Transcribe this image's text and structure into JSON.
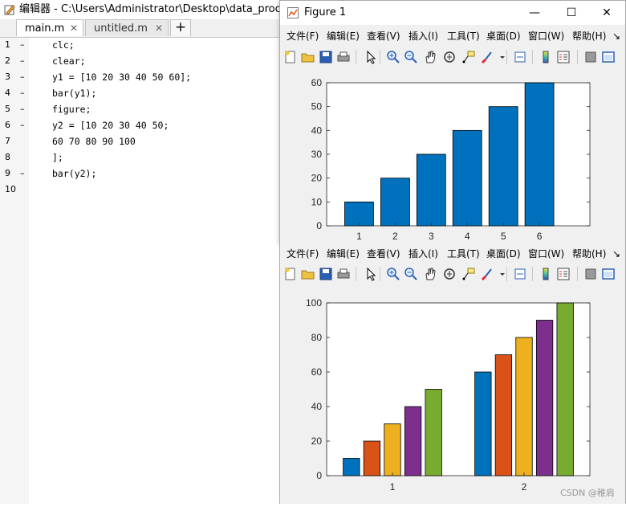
{
  "editor": {
    "title": "编辑器 - C:\\Users\\Administrator\\Desktop\\data_process\\",
    "tabs": [
      {
        "label": "main.m",
        "close": "✕"
      },
      {
        "label": "untitled.m",
        "close": "✕"
      }
    ],
    "add_tab": "+",
    "lines": [
      {
        "num": "1",
        "dash": "–",
        "code": "clc;"
      },
      {
        "num": "2",
        "dash": "–",
        "code": "clear;"
      },
      {
        "num": "3",
        "dash": "–",
        "code": "y1 = [10 20 30 40 50 60];"
      },
      {
        "num": "4",
        "dash": "–",
        "code": "bar(y1);"
      },
      {
        "num": "5",
        "dash": "–",
        "code": "figure;"
      },
      {
        "num": "6",
        "dash": "–",
        "code": "y2 = [10 20 30 40 50;"
      },
      {
        "num": "7",
        "dash": "",
        "code": "60 70 80 90 100"
      },
      {
        "num": "8",
        "dash": "",
        "code": "];"
      },
      {
        "num": "9",
        "dash": "–",
        "code": "bar(y2);"
      },
      {
        "num": "10",
        "dash": "",
        "code": ""
      }
    ]
  },
  "figure1": {
    "title": "Figure 1",
    "controls": {
      "minimize": "—",
      "maximize": "☐",
      "close": "✕"
    }
  },
  "menu": {
    "items": [
      "文件(F)",
      "编辑(E)",
      "查看(V)",
      "插入(I)",
      "工具(T)",
      "桌面(D)",
      "窗口(W)",
      "帮助(H)"
    ],
    "more": "↘"
  },
  "toolbar_icons": [
    "new-figure-icon",
    "open-icon",
    "save-icon",
    "print-icon",
    "pointer-icon",
    "zoom-in-icon",
    "zoom-out-icon",
    "pan-icon",
    "rotate-icon",
    "data-cursor-icon",
    "brush-icon",
    "link-icon",
    "colorbar-icon",
    "legend-icon",
    "hide-plot-tools-icon",
    "show-plot-tools-icon"
  ],
  "colors": {
    "bar_blue": "#0072BD",
    "series": [
      "#0072BD",
      "#D95319",
      "#EDB120",
      "#7E2F8E",
      "#77AC30"
    ]
  },
  "chart_data": [
    {
      "type": "bar",
      "categories": [
        "1",
        "2",
        "3",
        "4",
        "5",
        "6"
      ],
      "values": [
        10,
        20,
        30,
        40,
        50,
        60
      ],
      "ylim": [
        0,
        60
      ],
      "yticks": [
        "0",
        "10",
        "20",
        "30",
        "40",
        "50",
        "60"
      ],
      "grid": false
    },
    {
      "type": "bar",
      "categories": [
        "1",
        "2"
      ],
      "series": [
        {
          "values": [
            10,
            60
          ]
        },
        {
          "values": [
            20,
            70
          ]
        },
        {
          "values": [
            30,
            80
          ]
        },
        {
          "values": [
            40,
            90
          ]
        },
        {
          "values": [
            50,
            100
          ]
        }
      ],
      "ylim": [
        0,
        100
      ],
      "yticks": [
        "0",
        "20",
        "40",
        "60",
        "80",
        "100"
      ],
      "grid": false
    }
  ],
  "watermark": "CSDN @稚肩"
}
